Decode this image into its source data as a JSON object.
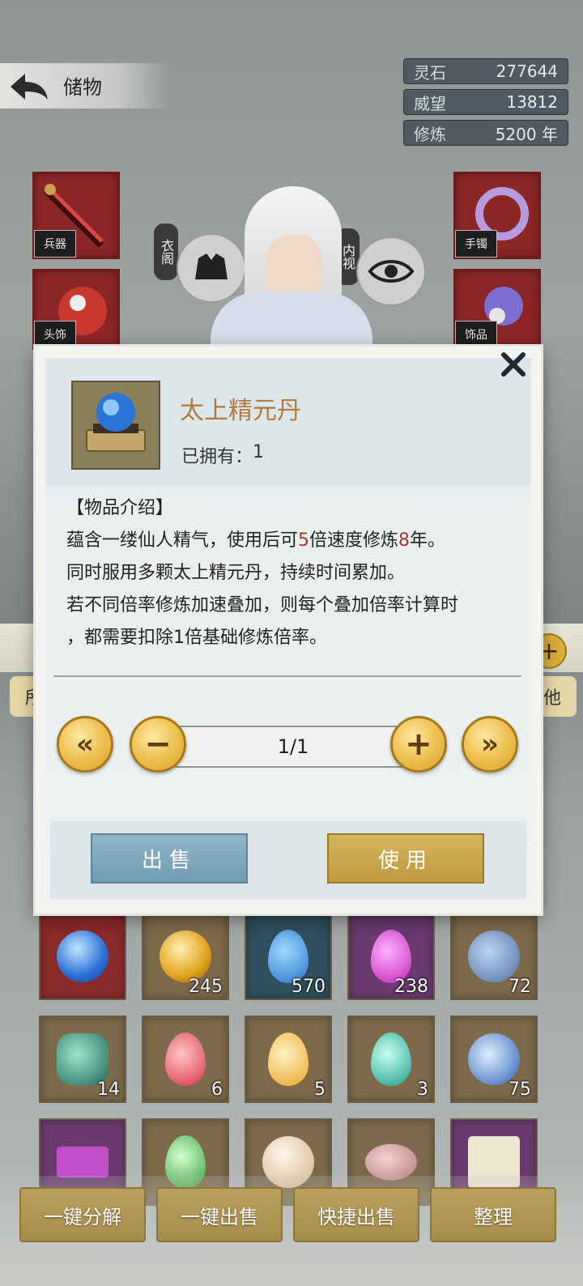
{
  "header": {
    "title": "储物",
    "resources": [
      {
        "label": "灵石",
        "value": "277644"
      },
      {
        "label": "威望",
        "value": "13812"
      },
      {
        "label": "修炼",
        "value": "5200 年"
      }
    ]
  },
  "equipment": {
    "left_tags": [
      "兵器",
      "头饰"
    ],
    "right_tags": [
      "手镯",
      "饰品"
    ],
    "wardrobe_label": "衣阁",
    "inner_view_label": "内视"
  },
  "filters": {
    "left_label": "所",
    "right_label": "他"
  },
  "modal": {
    "item_name": "太上精元丹",
    "owned_label": "已拥有：",
    "owned_count": "1",
    "desc_title": "【物品介绍】",
    "desc_line1_a": "蕴含一缕仙人精气，使用后可",
    "desc_line1_b": "5",
    "desc_line1_c": "倍速度修炼",
    "desc_line1_d": "8",
    "desc_line1_e": "年。",
    "desc_line2": "同时服用多颗太上精元丹，持续时间累加。",
    "desc_line3": "若不同倍率修炼加速叠加，则每个叠加倍率计算时",
    "desc_line4": "，都需要扣除1倍基础修炼倍率。",
    "quantity": "1/1",
    "sell_label": "出售",
    "use_label": "使用"
  },
  "inventory": {
    "rows": [
      [
        {
          "count": "",
          "color": "#8b2a2a",
          "kind": "orb-blue"
        },
        {
          "count": "245",
          "color": "#7d6a4a",
          "kind": "orb-gold"
        },
        {
          "count": "570",
          "color": "#2f4f5f",
          "kind": "drop-blue"
        },
        {
          "count": "238",
          "color": "#6b3a6f",
          "kind": "drop-pink"
        },
        {
          "count": "72",
          "color": "#7d6a4a",
          "kind": "leaf-blue"
        }
      ],
      [
        {
          "count": "14",
          "color": "#7d6a4a",
          "kind": "stone-green"
        },
        {
          "count": "6",
          "color": "#7d6a4a",
          "kind": "drop-red"
        },
        {
          "count": "5",
          "color": "#7d6a4a",
          "kind": "drop-yellow"
        },
        {
          "count": "3",
          "color": "#7d6a4a",
          "kind": "drop-teal"
        },
        {
          "count": "75",
          "color": "#7d6a4a",
          "kind": "bottle-blue"
        }
      ],
      [
        {
          "count": "",
          "color": "#6b3a6f",
          "kind": "powder-purple"
        },
        {
          "count": "",
          "color": "#7d6a4a",
          "kind": "crystal-green"
        },
        {
          "count": "",
          "color": "#7d6a4a",
          "kind": "orb-cream"
        },
        {
          "count": "",
          "color": "#7d6a4a",
          "kind": "bowl-pink"
        },
        {
          "count": "",
          "color": "#6b3a6f",
          "kind": "scroll"
        }
      ]
    ]
  },
  "actions": {
    "decompose_all": "一键分解",
    "sell_all": "一键出售",
    "quick_sell": "快捷出售",
    "sort": "整理"
  }
}
